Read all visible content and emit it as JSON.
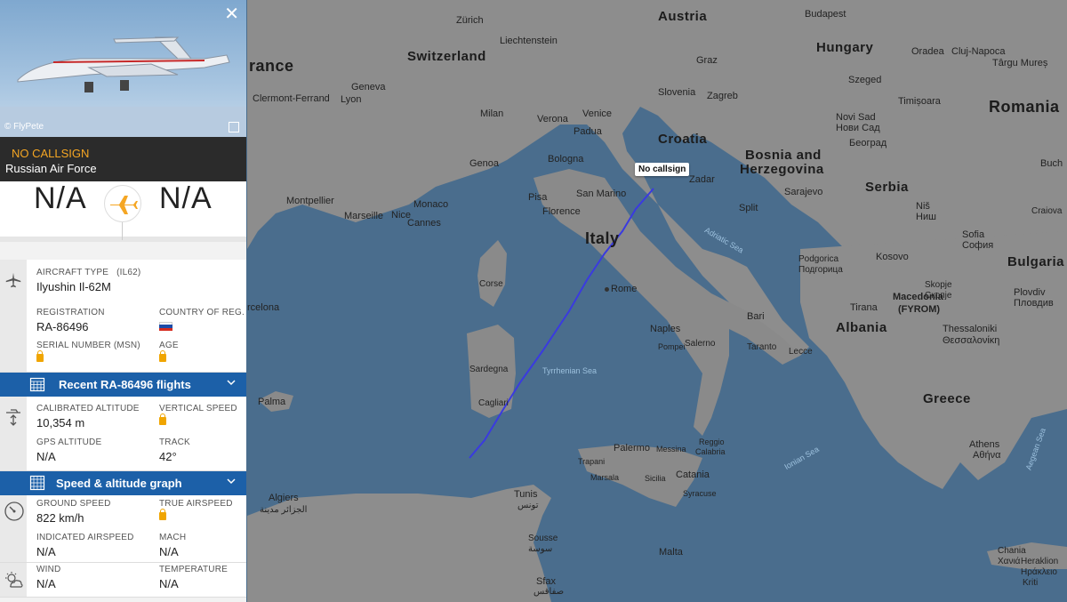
{
  "map": {
    "countries": {
      "austria": "Austria",
      "switzerland": "Switzerland",
      "france": "rance",
      "hungary": "Hungary",
      "romania": "Romania",
      "croatia": "Croatia",
      "bosnia1": "Bosnia and",
      "bosnia2": "Herzegovina",
      "serbia": "Serbia",
      "bulgaria": "Bulgaria",
      "italy": "Italy",
      "albania": "Albania",
      "greece": "Greece",
      "macedonia": "Macedonia",
      "fyrom": "(FYROM)"
    },
    "cities": {
      "zurich": "Zürich",
      "liechtenstein": "Liechtenstein",
      "graz": "Graz",
      "budapest": "Budapest",
      "cluj": "Cluj-Napoca",
      "cluj2": "Cluj-Napoca",
      "targu": "Târgu Mureș",
      "oradea": "Oradea",
      "geneva": "Geneva",
      "clermont": "Clermont-Ferrand",
      "lyon": "Lyon",
      "milan": "Milan",
      "venice": "Venice",
      "verona": "Verona",
      "padua": "Padua",
      "slovenia": "Slovenia",
      "zagreb": "Zagreb",
      "szeged": "Szeged",
      "timisoara": "Timișoara",
      "noviSad": "Novi Sad",
      "noviSadCyr": "Нови Сад",
      "beograd": "Београд",
      "genoa": "Genoa",
      "bologna": "Bologna",
      "sanMarino": "San Marino",
      "pisa": "Pisa",
      "florence": "Florence",
      "zadar": "Zadar",
      "split": "Split",
      "sarajevo": "Sarajevo",
      "nis": "Niš",
      "nisCyr": "Ниш",
      "montpellier": "Montpellier",
      "marseille": "Marseille",
      "monaco": "Monaco",
      "nice": "Nice",
      "cannes": "Cannes",
      "rome": "Rome",
      "corse": "Corse",
      "bari": "Bari",
      "naples": "Naples",
      "taranto": "Taranto",
      "lecce": "Lecce",
      "salerno": "Salerno",
      "pompei": "Pompei",
      "sardegna": "Sardegna",
      "cagliari": "Cagliari",
      "barcelona": "rcelona",
      "palma": "Palma",
      "palermo": "Palermo",
      "trapani": "Trapani",
      "marsala": "Marsala",
      "sicilia": "Sicilia",
      "catania": "Catania",
      "syracuse": "Syracuse",
      "reggio": "Reggio",
      "calabria": "Calabria",
      "messina": "Messina",
      "tunis": "Tunis",
      "tunisAr": "تونس",
      "algiers": "Algiers",
      "algiersAr": "الجزائر مدينة",
      "sousse": "Sousse",
      "sousseAr": "سوسة",
      "sfax": "Sfax",
      "sfaxAr": "صفاقس",
      "malta": "Malta",
      "kosovo": "Kosovo",
      "podgorica": "Podgorica",
      "podgoricaCyr": "Подгорица",
      "tirana": "Tirana",
      "skopje": "Skopje",
      "skopjeCyr": "Скопје",
      "sofia": "Sofia",
      "sofiaCyr": "София",
      "plovdiv": "Plovdiv",
      "plovdivCyr": "Пловдив",
      "thessaloniki": "Thessaloniki",
      "thessalonikiGr": "Θεσσαλονίκη",
      "athens": "Athens",
      "athensGr": "Αθήνα",
      "chania": "Chania",
      "chaniaGr": "Χανιά",
      "heraklion": "Heraklion",
      "heraklionGr": "Ηράκλειο",
      "kriti": "Kriti",
      "craiova": "Craiova",
      "buch": "Buch"
    },
    "seas": {
      "adriatic": "Adriatic Sea",
      "tyrrhenian": "Tyrrhenian Sea",
      "ionian": "Ionian Sea",
      "aegean": "Aegean Sea"
    },
    "callsign_tag": "No callsign",
    "colors": {
      "water": "#4a6d8d",
      "land": "#8c8c8c",
      "track": "#3a3ae0"
    }
  },
  "panel": {
    "photo_credit": "© FlyPete",
    "callsign": "NO CALLSIGN",
    "airline": "Russian Air Force",
    "origin": "N/A",
    "destination": "N/A",
    "aircraft_type_label": "AIRCRAFT TYPE",
    "aircraft_type_code": "(IL62)",
    "aircraft_type": "Ilyushin Il-62M",
    "registration_label": "REGISTRATION",
    "registration": "RA-86496",
    "country_label": "COUNTRY OF REG.",
    "serial_label": "SERIAL NUMBER (MSN)",
    "age_label": "AGE",
    "recent_flights": "Recent RA-86496 flights",
    "cal_alt_label": "CALIBRATED ALTITUDE",
    "cal_alt": "10,354 m",
    "vspeed_label": "VERTICAL SPEED",
    "gps_alt_label": "GPS ALTITUDE",
    "gps_alt": "N/A",
    "track_label": "TRACK",
    "track": "42°",
    "speed_graph": "Speed & altitude graph",
    "ground_speed_label": "GROUND SPEED",
    "ground_speed": "822 km/h",
    "true_airspeed_label": "TRUE AIRSPEED",
    "ias_label": "INDICATED AIRSPEED",
    "ias": "N/A",
    "mach_label": "MACH",
    "mach": "N/A",
    "wind_label": "WIND",
    "wind": "N/A",
    "temp_label": "TEMPERATURE",
    "temp": "N/A",
    "accent_color": "#f5a623",
    "bar_color": "#1c60a8"
  }
}
